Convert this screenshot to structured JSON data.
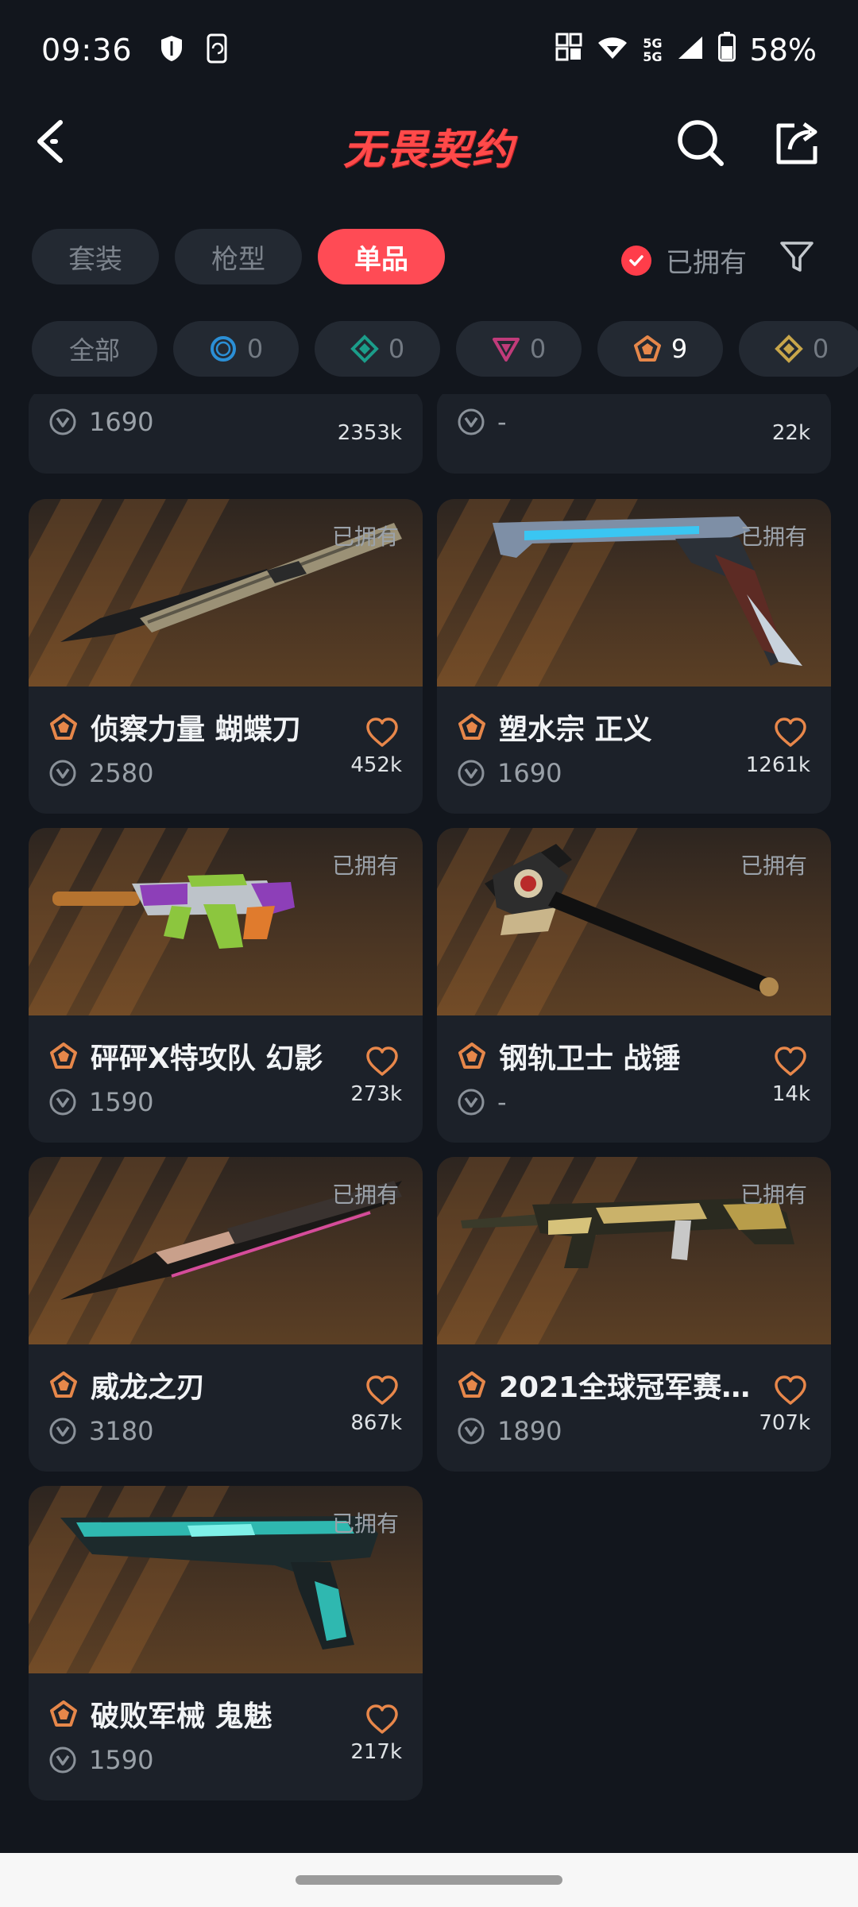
{
  "status": {
    "time": "09:36",
    "battery": "58%",
    "network_top": "5G",
    "network_bottom": "5G"
  },
  "header": {
    "title": "无畏契约"
  },
  "tabs": [
    {
      "label": "套装",
      "active": false
    },
    {
      "label": "枪型",
      "active": false
    },
    {
      "label": "单品",
      "active": true
    }
  ],
  "owned_filter": {
    "label": "已拥有",
    "checked": true
  },
  "rarity_chips": [
    {
      "label": "全部",
      "icon": "all"
    },
    {
      "icon": "select-tier-icon",
      "count": "0",
      "color": "#2b8fd6"
    },
    {
      "icon": "deluxe-tier-icon",
      "count": "0",
      "color": "#1b9d8a"
    },
    {
      "icon": "premium-tier-icon",
      "count": "0",
      "color": "#c03b7a"
    },
    {
      "icon": "exclusive-tier-icon",
      "count": "9",
      "color": "#e6874a"
    },
    {
      "icon": "ultra-tier-icon",
      "count": "0",
      "color": "#c8a64a"
    }
  ],
  "top_partial": [
    {
      "price": "1690",
      "count": "2353k"
    },
    {
      "price": "-",
      "count": "22k"
    }
  ],
  "items": [
    {
      "name": "侦察力量 蝴蝶刀",
      "price": "2580",
      "count": "452k",
      "owned": "已拥有",
      "weapon": "butterfly-knife"
    },
    {
      "name": "塑水宗 正义",
      "price": "1690",
      "count": "1261k",
      "owned": "已拥有",
      "weapon": "pistol-blue"
    },
    {
      "name": "砰砰X特攻队 幻影",
      "price": "1590",
      "count": "273k",
      "owned": "已拥有",
      "weapon": "rifle-green"
    },
    {
      "name": "钢轨卫士 战锤",
      "price": "-",
      "count": "14k",
      "owned": "已拥有",
      "weapon": "hammer"
    },
    {
      "name": "威龙之刃",
      "price": "3180",
      "count": "867k",
      "owned": "已拥有",
      "weapon": "dragon-blade"
    },
    {
      "name": "2021全球冠军赛...",
      "price": "1890",
      "count": "707k",
      "owned": "已拥有",
      "weapon": "rifle-gold"
    },
    {
      "name": "破败军械 鬼魅",
      "price": "1590",
      "count": "217k",
      "owned": "已拥有",
      "weapon": "pistol-ruin"
    }
  ]
}
